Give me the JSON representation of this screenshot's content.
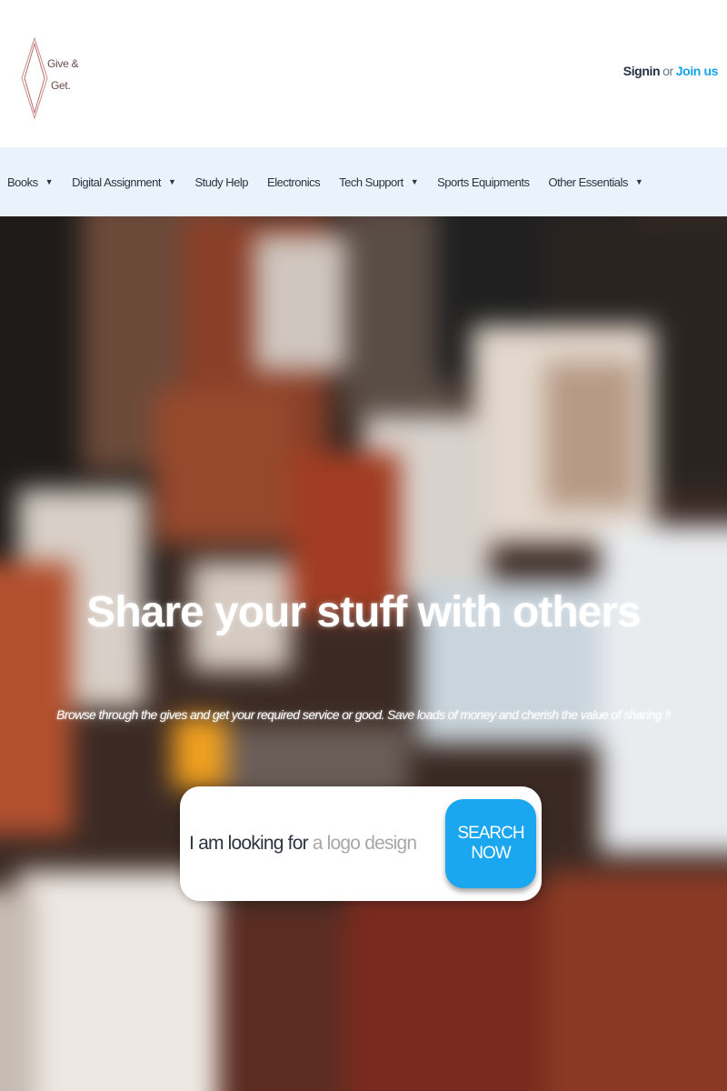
{
  "header": {
    "logo_line1": "Give &",
    "logo_line2": "Get.",
    "signin": "Signin",
    "or": "or",
    "join": "Join us"
  },
  "nav": {
    "items": [
      {
        "label": "Books",
        "dropdown": true
      },
      {
        "label": "Digital Assignment",
        "dropdown": true
      },
      {
        "label": "Study Help",
        "dropdown": false
      },
      {
        "label": "Electronics",
        "dropdown": false
      },
      {
        "label": "Tech Support",
        "dropdown": true
      },
      {
        "label": "Sports Equipments",
        "dropdown": false
      },
      {
        "label": "Other Essentials",
        "dropdown": true
      }
    ],
    "caret": "▼"
  },
  "hero": {
    "title": "Share your stuff with others",
    "subtitle": "Browse through the gives and get your required service or good. Save loads of money and cherish the value of sharing !!"
  },
  "search": {
    "label": "I am looking for",
    "placeholder": "a logo design",
    "button": "SEARCH NOW"
  },
  "colors": {
    "accent": "#1aa7f0",
    "nav_bg": "#eaf3fb",
    "dark_text": "#233142"
  }
}
